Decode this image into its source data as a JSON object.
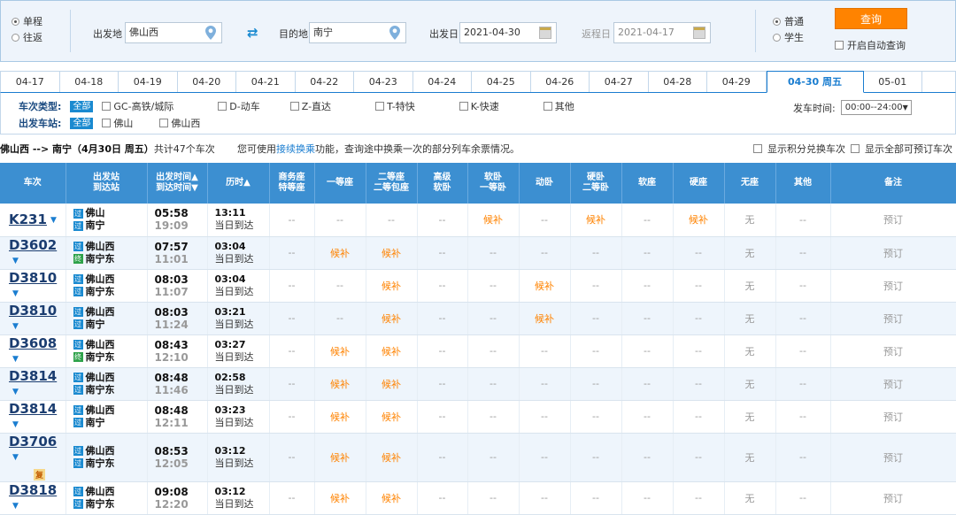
{
  "search": {
    "trip_one_way": "单程",
    "trip_round": "往返",
    "from_label": "出发地",
    "from_value": "佛山西",
    "to_label": "目的地",
    "to_value": "南宁",
    "depart_label": "出发日",
    "depart_value": "2021-04-30",
    "return_label": "返程日",
    "return_value": "2021-04-17",
    "pass_normal": "普通",
    "pass_student": "学生",
    "query_button": "查询",
    "auto_query": "开启自动查询"
  },
  "dates": [
    "04-17",
    "04-18",
    "04-19",
    "04-20",
    "04-21",
    "04-22",
    "04-23",
    "04-24",
    "04-25",
    "04-26",
    "04-27",
    "04-28",
    "04-29",
    "04-30 周五",
    "05-01"
  ],
  "active_date": "04-30 周五",
  "filters": {
    "type_label": "车次类型:",
    "all": "全部",
    "types": [
      "GC-高铁/城际",
      "D-动车",
      "Z-直达",
      "T-特快",
      "K-快速",
      "其他"
    ],
    "station_label": "出发车站:",
    "stations": [
      "佛山",
      "佛山西"
    ],
    "time_label": "发车时间:",
    "time_value": "00:00--24:00"
  },
  "summary": {
    "route": "佛山西 --> 南宁（4月30日  周五）",
    "count": "共计47个车次",
    "hint_pre": "您可使用",
    "hint_link": "接续换乘",
    "hint_post": "功能，查询途中换乘一次的部分列车余票情况。",
    "opt1": "显示积分兑换车次",
    "opt2": "显示全部可预订车次"
  },
  "columns": [
    "车次",
    "出发站|到达站",
    "出发时间▲|到达时间▼",
    "历时▲",
    "商务座|特等座",
    "一等座",
    "二等座|二等包座",
    "高级|软卧",
    "软卧|一等卧",
    "动卧",
    "硬卧|二等卧",
    "软座",
    "硬座",
    "无座",
    "其他",
    "备注"
  ],
  "trains": [
    {
      "no": "K231",
      "fu": "",
      "from": "佛山",
      "to": "南宁",
      "from_badge": "过",
      "to_badge": "过",
      "dep": "05:58",
      "arr": "19:09",
      "dur": "13:11",
      "day": "当日到达",
      "seats": [
        "--",
        "--",
        "--",
        "--",
        "候补",
        "--",
        "候补",
        "--",
        "候补",
        "无",
        "--"
      ],
      "book": "预订"
    },
    {
      "no": "D3602",
      "fu": "",
      "from": "佛山西",
      "to": "南宁东",
      "from_badge": "过",
      "to_badge": "终",
      "dep": "07:57",
      "arr": "11:01",
      "dur": "03:04",
      "day": "当日到达",
      "seats": [
        "--",
        "候补",
        "候补",
        "--",
        "--",
        "--",
        "--",
        "--",
        "--",
        "无",
        "--"
      ],
      "book": "预订"
    },
    {
      "no": "D3810",
      "fu": "",
      "from": "佛山西",
      "to": "南宁东",
      "from_badge": "过",
      "to_badge": "过",
      "dep": "08:03",
      "arr": "11:07",
      "dur": "03:04",
      "day": "当日到达",
      "seats": [
        "--",
        "--",
        "候补",
        "--",
        "--",
        "候补",
        "--",
        "--",
        "--",
        "无",
        "--"
      ],
      "book": "预订"
    },
    {
      "no": "D3810",
      "fu": "",
      "from": "佛山西",
      "to": "南宁",
      "from_badge": "过",
      "to_badge": "过",
      "dep": "08:03",
      "arr": "11:24",
      "dur": "03:21",
      "day": "当日到达",
      "seats": [
        "--",
        "--",
        "候补",
        "--",
        "--",
        "候补",
        "--",
        "--",
        "--",
        "无",
        "--"
      ],
      "book": "预订"
    },
    {
      "no": "D3608",
      "fu": "",
      "from": "佛山西",
      "to": "南宁东",
      "from_badge": "过",
      "to_badge": "终",
      "dep": "08:43",
      "arr": "12:10",
      "dur": "03:27",
      "day": "当日到达",
      "seats": [
        "--",
        "候补",
        "候补",
        "--",
        "--",
        "--",
        "--",
        "--",
        "--",
        "无",
        "--"
      ],
      "book": "预订"
    },
    {
      "no": "D3814",
      "fu": "",
      "from": "佛山西",
      "to": "南宁东",
      "from_badge": "过",
      "to_badge": "过",
      "dep": "08:48",
      "arr": "11:46",
      "dur": "02:58",
      "day": "当日到达",
      "seats": [
        "--",
        "候补",
        "候补",
        "--",
        "--",
        "--",
        "--",
        "--",
        "--",
        "无",
        "--"
      ],
      "book": "预订"
    },
    {
      "no": "D3814",
      "fu": "",
      "from": "佛山西",
      "to": "南宁",
      "from_badge": "过",
      "to_badge": "过",
      "dep": "08:48",
      "arr": "12:11",
      "dur": "03:23",
      "day": "当日到达",
      "seats": [
        "--",
        "候补",
        "候补",
        "--",
        "--",
        "--",
        "--",
        "--",
        "--",
        "无",
        "--"
      ],
      "book": "预订"
    },
    {
      "no": "D3706",
      "fu": "复",
      "from": "佛山西",
      "to": "南宁东",
      "from_badge": "过",
      "to_badge": "过",
      "dep": "08:53",
      "arr": "12:05",
      "dur": "03:12",
      "day": "当日到达",
      "seats": [
        "--",
        "候补",
        "候补",
        "--",
        "--",
        "--",
        "--",
        "--",
        "--",
        "无",
        "--"
      ],
      "book": "预订"
    },
    {
      "no": "D3818",
      "fu": "",
      "from": "佛山西",
      "to": "南宁东",
      "from_badge": "过",
      "to_badge": "过",
      "dep": "09:08",
      "arr": "12:20",
      "dur": "03:12",
      "day": "当日到达",
      "seats": [
        "--",
        "候补",
        "候补",
        "--",
        "--",
        "--",
        "--",
        "--",
        "--",
        "无",
        "--"
      ],
      "book": "预订"
    }
  ]
}
